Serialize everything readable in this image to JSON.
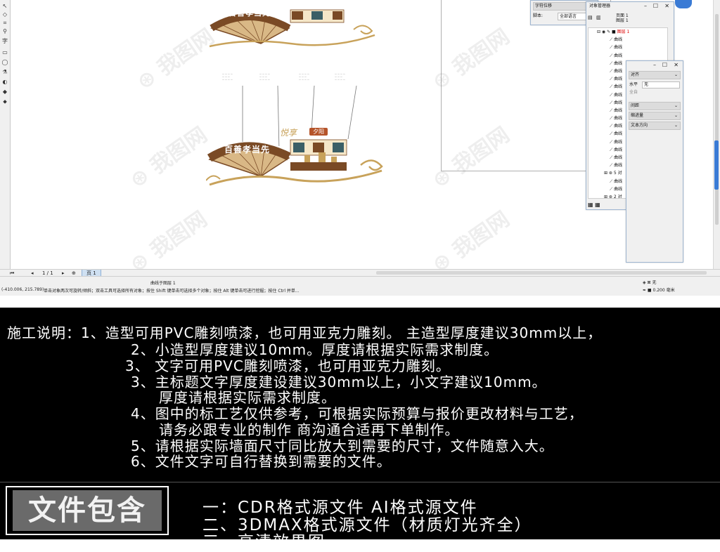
{
  "toolbox": {
    "tools": [
      "pick-icon",
      "shape-icon",
      "crop-icon",
      "zoom-icon",
      "freehand-icon",
      "smart-fill-icon",
      "rectangle-icon",
      "ellipse-icon",
      "polygon-icon",
      "text-icon",
      "parallel-dim-icon",
      "connector-icon",
      "blend-icon",
      "transparency-icon",
      "eyedropper-icon",
      "outline-icon",
      "fill-icon",
      "interactive-fill-icon"
    ],
    "text_glyph": "字"
  },
  "design": {
    "top_title": "百善孝当先",
    "mid_title": "百善孝当先",
    "badge_text": "夕阳",
    "side_title": "悦享",
    "colors": {
      "brown": "#7a4a25",
      "gold": "#c8a25a",
      "cream": "#f5e7c8",
      "fan_light": "#d9b886"
    }
  },
  "dockers": {
    "char_panel": {
      "item1": "字符位移",
      "script_label": "脚本:",
      "script_value": "全部语言"
    },
    "object_manager": {
      "title": "对象管理器",
      "page_label": "页面 1",
      "layer_label": "图层 1",
      "active_layer": "图层 1",
      "rows": [
        "曲线",
        "曲线",
        "曲线",
        "曲线",
        "曲线",
        "曲线",
        "曲线",
        "曲线",
        "曲线",
        "曲线",
        "曲线",
        "曲线",
        "曲线",
        "曲线",
        "曲线",
        "曲线",
        "曲线",
        "5 对",
        "曲线",
        "曲线",
        "2 对"
      ]
    },
    "align_panel": {
      "title": "对齐",
      "horizontal_label": "水平",
      "horizontal_value": "无",
      "checkbox_label": "全自",
      "sections": [
        "间距",
        "缩进量",
        "文本方向"
      ]
    }
  },
  "hbar": {
    "page_counter": "1 / 1",
    "page_tab": "页 1"
  },
  "status": {
    "object_info": "曲线于图层 1",
    "coords": "(-410.006, 215.789)",
    "hint": "单击对象两次可旋转/倾斜；双击工具可选择所有对象；按住 Shift 键单击可选择多个对象；按住 Alt 键单击可进行挖掘；按住 Ctrl 并单...",
    "fill_label": "无",
    "outline_label": "0.200 毫米"
  },
  "notes": {
    "lines": [
      "施工说明：1、造型可用PVC雕刻喷漆，也可用亚克力雕刻。  主造型厚度建议30mm以上，",
      "2、小造型厚度建议10mm。厚度请根据实际需求制度。",
      "3、 文字可用PVC雕刻喷漆，也可用亚克力雕刻。",
      "3、主标题文字厚度建设建议30mm以上，小文字建议10mm。",
      "厚度请根据实际需求制度。",
      "4、图中的标工艺仅供参考，可根据实际预算与报价更改材料与工艺，",
      "请务必跟专业的制作 商沟通合适再下单制作。",
      "5、请根据实际墙面尺寸同比放大到需要的尺寸，文件随意入大。",
      "6、文件文字可自行替换到需要的文件。"
    ]
  },
  "package": {
    "title": "文件包含",
    "lines": [
      "一：CDR格式源文件  AI格式源文件",
      "二、3DMAX格式源文件（材质灯光齐全）",
      "三、高清效果图"
    ]
  }
}
